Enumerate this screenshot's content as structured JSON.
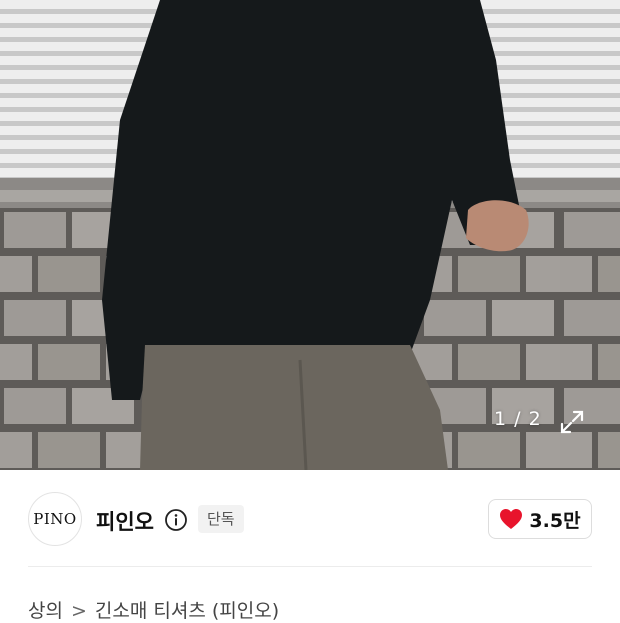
{
  "gallery": {
    "counter": "1 / 2",
    "expand_icon": "expand-arrows-icon"
  },
  "brand": {
    "logo_text": "PINO",
    "name": "피인오",
    "info_icon": "info-circle-icon",
    "badge": "단독"
  },
  "like": {
    "icon": "heart-icon",
    "count": "3.5만",
    "color": "#e8142c"
  },
  "breadcrumb": {
    "category": "상의",
    "separator": ">",
    "subcategory": "긴소매 티셔츠 (피인오)"
  }
}
